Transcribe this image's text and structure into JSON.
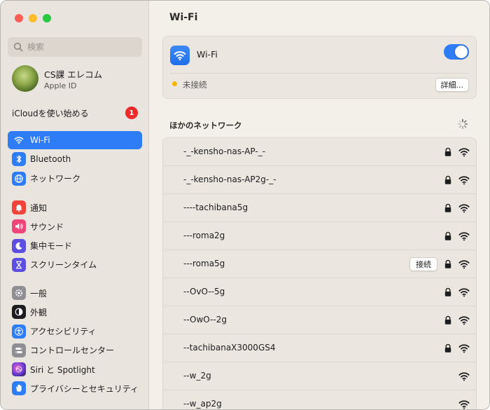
{
  "window": {
    "traffic_lights": [
      "close",
      "minimize",
      "maximize"
    ]
  },
  "sidebar": {
    "search_placeholder": "検索",
    "account": {
      "name": "CS課 エレコム",
      "subtitle": "Apple ID"
    },
    "icloud": {
      "label": "iCloudを使い始める",
      "badge": "1"
    },
    "groups": [
      [
        {
          "label": "Wi-Fi",
          "icon": "wifi-icon",
          "color": "#2e7cf6",
          "active": true
        },
        {
          "label": "Bluetooth",
          "icon": "bluetooth-icon",
          "color": "#2e7cf6",
          "active": false
        },
        {
          "label": "ネットワーク",
          "icon": "globe-icon",
          "color": "#2e7cf6",
          "active": false
        }
      ],
      [
        {
          "label": "通知",
          "icon": "bell-icon",
          "color": "#f0443b",
          "active": false
        },
        {
          "label": "サウンド",
          "icon": "speaker-icon",
          "color": "#f0457a",
          "active": false
        },
        {
          "label": "集中モード",
          "icon": "moon-icon",
          "color": "#5b4ee0",
          "active": false
        },
        {
          "label": "スクリーンタイム",
          "icon": "hourglass-icon",
          "color": "#5b4ee0",
          "active": false
        }
      ],
      [
        {
          "label": "一般",
          "icon": "gear-icon",
          "color": "#8e8e93",
          "active": false
        },
        {
          "label": "外観",
          "icon": "appearance-icon",
          "color": "#1c1c1e",
          "active": false
        },
        {
          "label": "アクセシビリティ",
          "icon": "accessibility-icon",
          "color": "#2e7cf6",
          "active": false
        },
        {
          "label": "コントロールセンター",
          "icon": "control-center-icon",
          "color": "#8e8e93",
          "active": false
        },
        {
          "label": "Siri と Spotlight",
          "icon": "siri-icon",
          "color": "#b84fd8",
          "active": false
        },
        {
          "label": "プライバシーとセキュリティ",
          "icon": "hand-icon",
          "color": "#2e7cf6",
          "active": false
        }
      ]
    ]
  },
  "main": {
    "title": "Wi-Fi",
    "wifi_card": {
      "label": "Wi-Fi",
      "toggle_on": true,
      "status": "未接続",
      "status_color": "#f5b800",
      "details_button": "詳細..."
    },
    "other_networks_title": "ほかのネットワーク",
    "join_button": "接続",
    "networks": [
      {
        "name": "-_-kensho-nas-AP-_-",
        "locked": true,
        "join": false
      },
      {
        "name": "-_-kensho-nas-AP2g-_-",
        "locked": true,
        "join": false
      },
      {
        "name": "----tachibana5g",
        "locked": true,
        "join": false
      },
      {
        "name": "---roma2g",
        "locked": true,
        "join": false
      },
      {
        "name": "---roma5g",
        "locked": true,
        "join": true
      },
      {
        "name": "--OvO--5g",
        "locked": true,
        "join": false
      },
      {
        "name": "--OwO--2g",
        "locked": true,
        "join": false
      },
      {
        "name": "--tachibanaX3000GS4",
        "locked": true,
        "join": false
      },
      {
        "name": "--w_2g",
        "locked": false,
        "join": false
      },
      {
        "name": "--w_ap2g",
        "locked": false,
        "join": false
      }
    ]
  },
  "colors": {
    "accent": "#2e7cf6",
    "badge": "#f02a2a"
  }
}
